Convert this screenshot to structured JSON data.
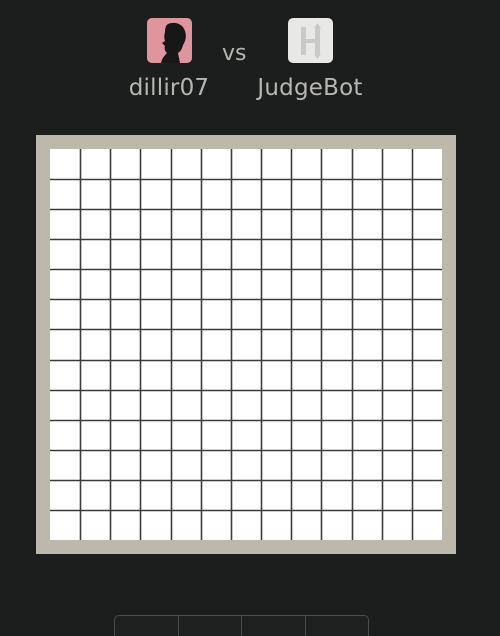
{
  "players": {
    "player1": {
      "name": "dillir07",
      "avatar_icon": "person-silhouette-icon",
      "avatar_color": "#d98a94"
    },
    "separator": "vs",
    "player2": {
      "name": "JudgeBot",
      "avatar_icon": "h-logo-icon",
      "avatar_color": "#e8e8e6"
    }
  },
  "board": {
    "type": "gomoku-grid",
    "rows": 13,
    "cols": 13,
    "frame_color": "#bcb8ab",
    "cell_color": "#ffffff",
    "line_color": "#3c3c3c",
    "stones": []
  },
  "toolbar": {
    "buttons": [
      "first-move-button",
      "previous-move-button",
      "next-move-button",
      "last-move-button"
    ]
  }
}
